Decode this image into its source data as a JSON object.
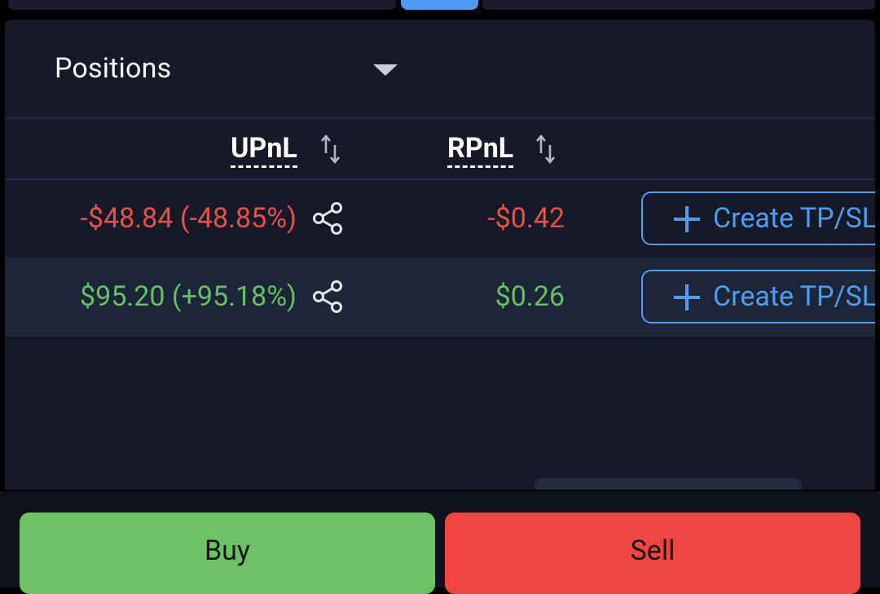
{
  "panel": {
    "title": "Positions"
  },
  "columns": {
    "upnl": "UPnL",
    "rpnl": "RPnL"
  },
  "rows": [
    {
      "upnl": "-$48.84 (-48.85%)",
      "rpnl": "-$0.42",
      "action": "Create TP/SL"
    },
    {
      "upnl": "$95.20 (+95.18%)",
      "rpnl": "$0.26",
      "action": "Create TP/SL"
    }
  ],
  "actions": {
    "buy": "Buy",
    "sell": "Sell"
  },
  "colors": {
    "accent": "#4f9cf5",
    "negative": "#e8504a",
    "positive": "#68be63",
    "buy": "#6cc364",
    "sell": "#f1463f"
  }
}
